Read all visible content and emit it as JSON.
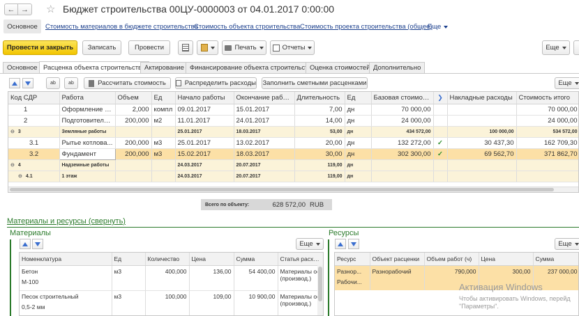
{
  "title": "Бюджет строительства 00ЦУ-0000003 от 04.01.2017 0:00:00",
  "header_links": {
    "main": "Основное",
    "link1": "Стоимость материалов в бюджете строительства",
    "link2": "Стоимость объекта строительства",
    "link3": "Стоимость проекта строительства (общее)",
    "more": "Еще"
  },
  "toolbar": {
    "post_close": "Провести и закрыть",
    "save": "Записать",
    "post": "Провести",
    "print": "Печать",
    "reports": "Отчеты",
    "more": "Еще"
  },
  "tabs": [
    "Основное",
    "Расценка объекта строительства",
    "Актирование",
    "Финансирование объекта строительства",
    "Оценка стоимостей",
    "Дополнительно"
  ],
  "grid_toolbar": {
    "calc": "Рассчитать стоимость",
    "distribute": "Распределить расходы",
    "fill": "Заполнить сметными расценками",
    "more": "Еще"
  },
  "grid": {
    "headers": [
      "Код СДР",
      "Работа",
      "Объем",
      "Ед",
      "Начало работы",
      "Окончание работы",
      "Длительность",
      "Ед",
      "Базовая стоимость",
      "",
      "Накладные расходы",
      "Стоимость итого"
    ],
    "rows": [
      {
        "code": "1",
        "work": "Оформление д...",
        "volume": "2,000",
        "unit": "компл",
        "start": "09.01.2017",
        "end": "15.01.2017",
        "dur": "7,00",
        "dunit": "дн",
        "base": "70 000,00",
        "check": "",
        "overhead": "",
        "total": "70 000,00"
      },
      {
        "code": "2",
        "work": "Подготовитель...",
        "volume": "200,000",
        "unit": "м2",
        "start": "11.01.2017",
        "end": "24.01.2017",
        "dur": "14,00",
        "dunit": "дн",
        "base": "24 000,00",
        "check": "",
        "overhead": "",
        "total": "24 000,00"
      },
      {
        "code": "3",
        "work": "Земляные работы",
        "volume": "",
        "unit": "",
        "start": "25.01.2017",
        "end": "18.03.2017",
        "dur": "53,00",
        "dunit": "дн",
        "base": "434 572,00",
        "check": "",
        "overhead": "100 000,00",
        "total": "534 572,00"
      },
      {
        "code": "3.1",
        "work": "Рытье котлова...",
        "volume": "200,000",
        "unit": "м3",
        "start": "25.01.2017",
        "end": "13.02.2017",
        "dur": "20,00",
        "dunit": "дн",
        "base": "132 272,00",
        "check": "✓",
        "overhead": "30 437,30",
        "total": "162 709,30"
      },
      {
        "code": "3.2",
        "work": "Фундамент",
        "volume": "200,000",
        "unit": "м3",
        "start": "15.02.2017",
        "end": "18.03.2017",
        "dur": "30,00",
        "dunit": "дн",
        "base": "302 300,00",
        "check": "✓",
        "overhead": "69 562,70",
        "total": "371 862,70"
      },
      {
        "code": "4",
        "work": "Надземные работы",
        "volume": "",
        "unit": "",
        "start": "24.03.2017",
        "end": "20.07.2017",
        "dur": "119,00",
        "dunit": "дн",
        "base": "",
        "check": "",
        "overhead": "",
        "total": ""
      },
      {
        "code": "4.1",
        "work": "1 этаж",
        "volume": "",
        "unit": "",
        "start": "24.03.2017",
        "end": "20.07.2017",
        "dur": "119,00",
        "dunit": "дн",
        "base": "",
        "check": "",
        "overhead": "",
        "total": ""
      }
    ]
  },
  "total": {
    "label": "Всего по объекту:",
    "value": "628 572,00",
    "currency": "RUB"
  },
  "materials_section": {
    "title": "Материалы и ресурсы (свернуть)",
    "materials": "Материалы",
    "resources": "Ресурсы",
    "more": "Еще"
  },
  "materials": {
    "headers": [
      "Номенклатура",
      "Ед",
      "Количество",
      "Цена",
      "Сумма",
      "Статья расходов"
    ],
    "rows": [
      {
        "name": "Бетон",
        "name2": "М-100",
        "unit": "м3",
        "qty": "400,000",
        "price": "136,00",
        "sum": "54 400,00",
        "article": "Материалы основны",
        "article2": "(производ.)"
      },
      {
        "name": "Песок строительный",
        "name2": "0,5-2 мм",
        "unit": "м3",
        "qty": "100,000",
        "price": "109,00",
        "sum": "10 900,00",
        "article": "Материалы основны",
        "article2": "(производ.)"
      }
    ]
  },
  "resources": {
    "headers": [
      "Ресурс",
      "Объект расценки",
      "Объем работ (ч)",
      "Цена",
      "Сумма"
    ],
    "rows": [
      {
        "res": "Разнор...",
        "res2": "Рабочи...",
        "obj": "Разнорабочий",
        "vol": "790,000",
        "price": "300,00",
        "sum": "237 000,00"
      }
    ]
  },
  "watermark": {
    "line1": "Активация Windows",
    "line2": "Чтобы активировать Windows, перейд",
    "line3": "\"Параметры\"."
  }
}
